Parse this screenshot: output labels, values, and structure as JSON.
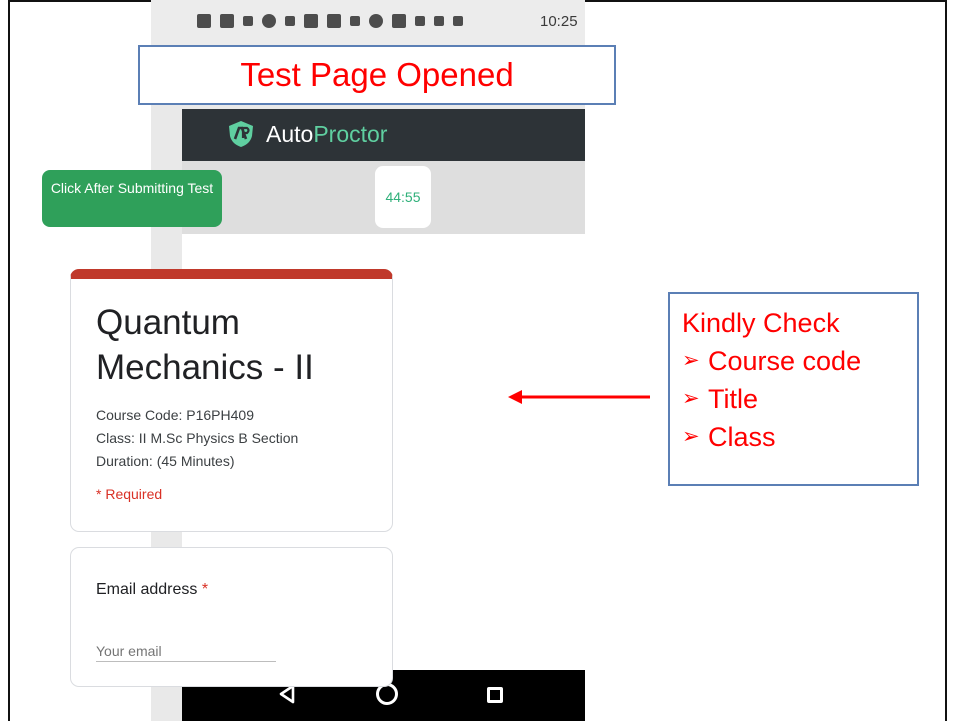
{
  "status_bar": {
    "time": "10:25"
  },
  "annotations": {
    "banner": "Test Page Opened",
    "callout_heading": "Kindly Check",
    "callout_items": [
      "Course code",
      "Title",
      "Class"
    ],
    "callout_bullet_icon": "arrowhead-bullet-icon",
    "color": "#ff0000"
  },
  "app": {
    "brand_part1": "Auto",
    "brand_part2": "Proctor",
    "logo_icon": "autoproctor-shield-logo",
    "accent_color": "#5fcfa0",
    "submit_button": "Click After Submitting Test",
    "timer": "44:55"
  },
  "form": {
    "title": "Quantum Mechanics - II",
    "course_code": "Course Code: P16PH409",
    "class": "Class: II M.Sc Physics B Section",
    "duration": "Duration: (45 Minutes)",
    "required_note": "* Required",
    "email_label": "Email address",
    "required_star": "*",
    "email_placeholder": "Your email",
    "header_color": "#c0392b"
  },
  "nav": {
    "back_icon": "back-triangle-icon",
    "home_icon": "home-circle-icon",
    "recent_icon": "recent-apps-square-icon"
  }
}
